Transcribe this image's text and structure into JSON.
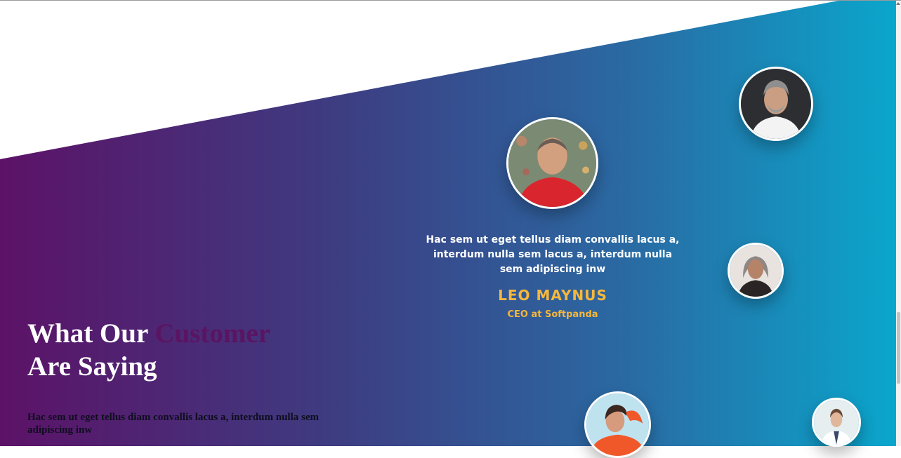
{
  "section": {
    "heading_part1": "What Our ",
    "heading_accent": "Customer",
    "heading_part2": "Are Saying",
    "lead": "Hac sem ut eget tellus diam convallis lacus a, interdum nulla sem adipiscing inw"
  },
  "testimonial": {
    "quote": "Hac sem ut eget tellus diam convallis lacus a, interdum nulla sem lacus a, interdum nulla sem adipiscing inw",
    "name": "LEO MAYNUS",
    "role": "CEO at Softpanda"
  },
  "colors": {
    "gradient_start": "#5c1267",
    "gradient_end": "#0aa6cc",
    "accent_text": "#5a1462",
    "name_gold": "#f7b73a"
  }
}
